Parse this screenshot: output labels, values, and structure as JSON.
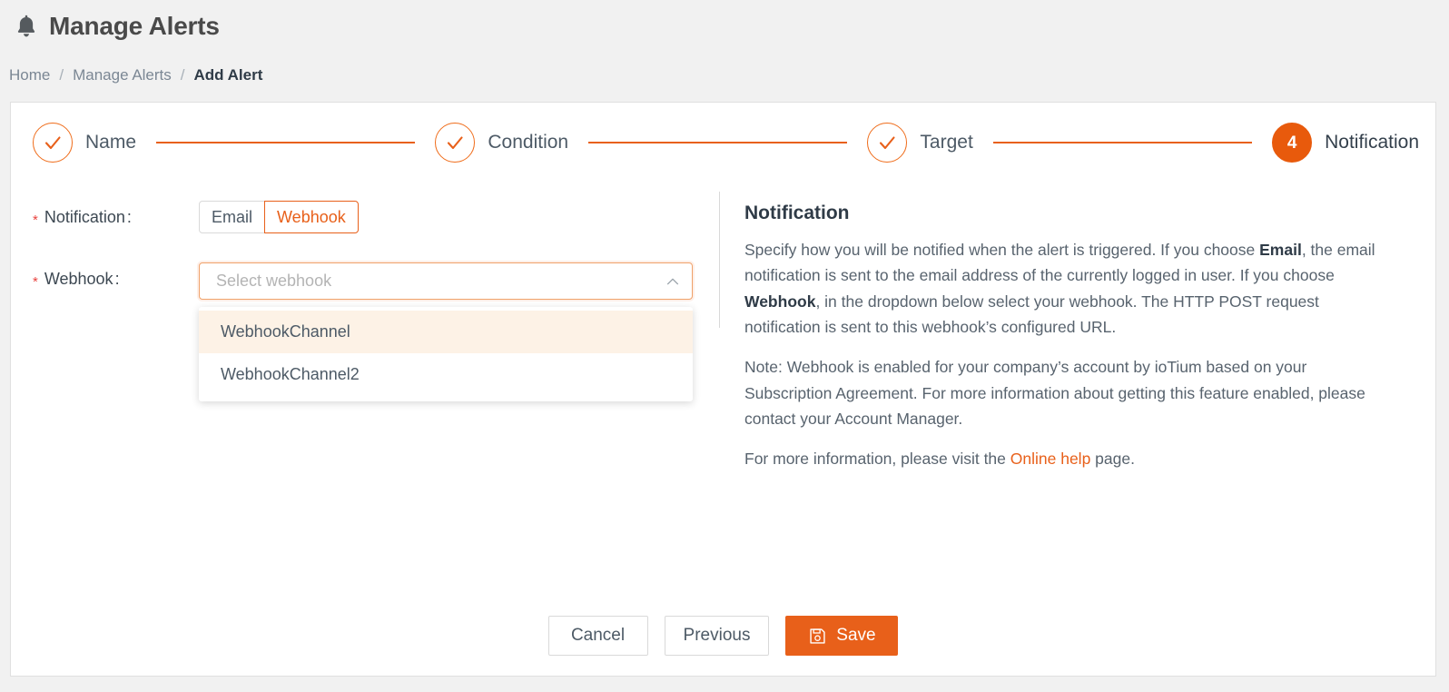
{
  "header": {
    "icon": "bell-icon",
    "title": "Manage Alerts"
  },
  "breadcrumb": {
    "items": [
      {
        "label": "Home",
        "current": false
      },
      {
        "label": "Manage Alerts",
        "current": false
      },
      {
        "label": "Add Alert",
        "current": true
      }
    ],
    "separator": "/"
  },
  "stepper": {
    "steps": [
      {
        "number": "1",
        "label": "Name",
        "state": "completed"
      },
      {
        "number": "2",
        "label": "Condition",
        "state": "completed"
      },
      {
        "number": "3",
        "label": "Target",
        "state": "completed"
      },
      {
        "number": "4",
        "label": "Notification",
        "state": "active"
      }
    ]
  },
  "form": {
    "notification": {
      "required_mark": "*",
      "label": "Notification",
      "colon": ":",
      "options": [
        {
          "label": "Email",
          "selected": false
        },
        {
          "label": "Webhook",
          "selected": true
        }
      ]
    },
    "webhook": {
      "required_mark": "*",
      "label": "Webhook",
      "colon": ":",
      "placeholder": "Select webhook",
      "value": "",
      "expanded": true,
      "chevron": "chevron-up-icon",
      "options": [
        {
          "label": "WebhookChannel",
          "highlighted": true
        },
        {
          "label": "WebhookChannel2",
          "highlighted": false
        }
      ]
    }
  },
  "help": {
    "title": "Notification",
    "p1_a": "Specify how you will be notified when the alert is triggered. If you choose ",
    "p1_b": "Email",
    "p1_c": ", the email notification is sent to the email address of the currently logged in user. If you choose ",
    "p1_d": "Webhook",
    "p1_e": ", in the dropdown below select your webhook. The HTTP POST request notification is sent to this webhook’s configured URL.",
    "p2": "Note: Webhook is enabled for your company’s account by ioTium based on your Subscription Agreement. For more information about getting this feature enabled, please contact your Account Manager.",
    "p3_a": "For more information, please visit the ",
    "p3_link": "Online help",
    "p3_b": " page."
  },
  "footer": {
    "cancel_label": "Cancel",
    "previous_label": "Previous",
    "save_label": "Save",
    "save_icon": "save-floppy-icon"
  },
  "colors": {
    "accent": "#e8601a",
    "accent_light": "#fdf2e6",
    "required": "#e8433f",
    "text": "#4d5a66",
    "page_bg": "#f1f1f1"
  }
}
